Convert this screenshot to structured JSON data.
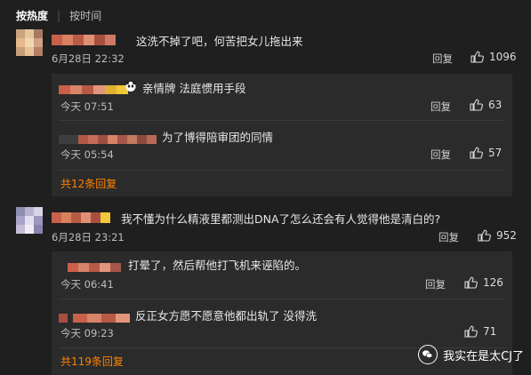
{
  "sort": {
    "hot": "按热度",
    "time": "按时间"
  },
  "comments": [
    {
      "text": "这洗不掉了吧，何苦把女儿拖出来",
      "time": "6月28日 22:32",
      "reply_label": "回复",
      "likes": "1096",
      "replies": [
        {
          "text": "亲情牌  法庭惯用手段",
          "time": "今天 07:51",
          "reply_label": "回复",
          "likes": "63"
        },
        {
          "text": "为了博得陪审团的同情",
          "time": "今天 05:54",
          "reply_label": "回复",
          "likes": "57"
        }
      ],
      "more": "共12条回复"
    },
    {
      "text": "我不懂为什么精液里都测出DNA了怎么还会有人觉得他是清白的?",
      "time": "6月28日 23:21",
      "reply_label": "回复",
      "likes": "952",
      "replies": [
        {
          "text": "打晕了，然后帮他打飞机来诬陷的。",
          "time": "今天 06:41",
          "reply_label": "回复",
          "likes": "126"
        },
        {
          "text": "反正女方愿不愿意他都出轨了 没得洗",
          "time": "今天 09:23",
          "reply_label": "回复",
          "likes": "71"
        }
      ],
      "more": "共119条回复"
    }
  ],
  "watermark": {
    "text": "我实在是太CJ了"
  },
  "colors": {
    "background": "#1f1f1f",
    "reply_panel": "#2b2b2b",
    "accent": "#ff8200",
    "text": "#e6e6e6",
    "muted": "#bdbdbd"
  }
}
